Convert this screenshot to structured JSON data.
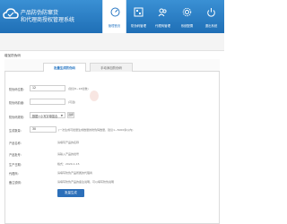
{
  "app": {
    "title_line1": "产品防伪防窜货",
    "title_line2": "和代理商授权管理系统"
  },
  "nav": {
    "items": [
      {
        "label": "管理首页",
        "icon": "gauge-icon",
        "active": true
      },
      {
        "label": "防伪码管理",
        "icon": "qrcode-icon",
        "active": false
      },
      {
        "label": "代理商管理",
        "icon": "users-icon",
        "active": false
      },
      {
        "label": "系统配置",
        "icon": "gear-icon",
        "active": false
      },
      {
        "label": "退出系统",
        "icon": "power-icon",
        "active": false
      }
    ]
  },
  "breadcrumb": "增加防伪码",
  "tabs": [
    {
      "label": "批量生成防伪码",
      "active": true
    },
    {
      "label": "手动添加防伪码",
      "active": false
    }
  ],
  "form": {
    "row1": {
      "label": "防伪码位数：",
      "value": "12",
      "hint": "(建议8~16位数)"
    },
    "row2": {
      "label": "防伪码前缀：",
      "value": "",
      "hint": "(可选)"
    },
    "row3": {
      "label": "防伪码规则：",
      "value": "数据+小写字母混合",
      "button": "选择"
    },
    "row4": {
      "label": "生成数量：",
      "value": "30",
      "hint": "(一次生成可批量生成数量的防伪码数量，建议1~5000条以内)"
    },
    "row5": {
      "label": "产品名称：",
      "hint": "请填写产品的名称"
    },
    "row6": {
      "label": "产品批号：",
      "hint": "请输入产品的批号"
    },
    "row7": {
      "label": "生产日期：",
      "hint": "格式：2020-1-15"
    },
    "row8": {
      "label": "代理商：",
      "hint": "请填写防伪产品所属的代理商"
    },
    "row9": {
      "label": "备注说明：",
      "hint": "请填写防伪产品的备注说明，可以填写防伪说明"
    }
  },
  "actions": {
    "submit_label": "批量生成"
  },
  "colors": {
    "header": "#2a78c4",
    "accent": "#2c6fb9"
  }
}
